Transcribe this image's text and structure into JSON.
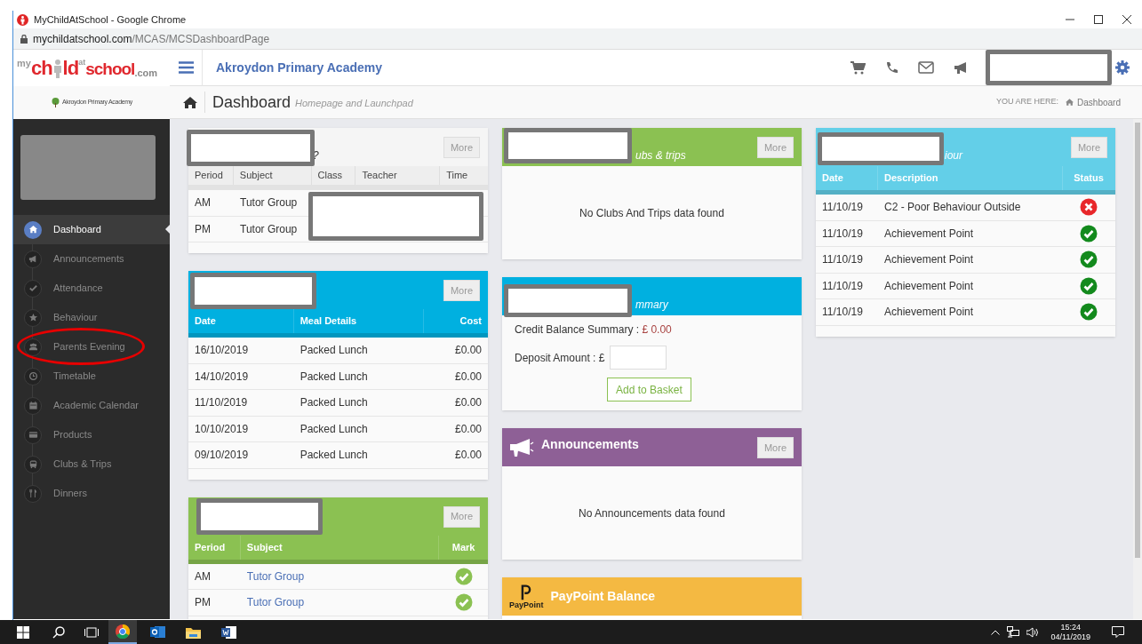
{
  "browser": {
    "title": "MyChildAtSchool - Google Chrome",
    "url_host": "mychildatschool.com",
    "url_path": "/MCAS/MCSDashboardPage"
  },
  "logo": {
    "parts": [
      "my",
      "ch",
      "ld",
      "at",
      "school",
      ".com"
    ]
  },
  "school_logo": {
    "name": "Akroydon Primary Academy"
  },
  "sidebar": {
    "items": [
      {
        "label": "Dashboard",
        "selected": true,
        "circled": false
      },
      {
        "label": "Announcements",
        "selected": false,
        "circled": false
      },
      {
        "label": "Attendance",
        "selected": false,
        "circled": false
      },
      {
        "label": "Behaviour",
        "selected": false,
        "circled": false
      },
      {
        "label": "Parents Evening",
        "selected": false,
        "circled": true
      },
      {
        "label": "Timetable",
        "selected": false,
        "circled": false
      },
      {
        "label": "Academic Calendar",
        "selected": false,
        "circled": false
      },
      {
        "label": "Products",
        "selected": false,
        "circled": false
      },
      {
        "label": "Clubs & Trips",
        "selected": false,
        "circled": false
      },
      {
        "label": "Dinners",
        "selected": false,
        "circled": false
      }
    ]
  },
  "topbar": {
    "title": "Akroydon Primary Academy"
  },
  "breadcrumb": {
    "title": "Dashboard",
    "subtitle": "Homepage and Launchpad",
    "label": "YOU ARE HERE:",
    "current": "Dashboard"
  },
  "columns": [
    {
      "cards": [
        {
          "kind": "table",
          "color": "#f5f5f5",
          "title_fragment": "?",
          "more": "More",
          "table": {
            "columns": [
              {
                "label": "Period",
                "kind": "text"
              },
              {
                "label": "Subject",
                "kind": "text"
              },
              {
                "label": "Class",
                "kind": "text"
              },
              {
                "label": "Teacher",
                "kind": "text"
              },
              {
                "label": "Time",
                "kind": "text"
              }
            ],
            "rows": [
              [
                "AM",
                "Tutor Group"
              ],
              [
                "PM",
                "Tutor Group"
              ]
            ]
          }
        },
        {
          "kind": "table",
          "color": "#00b0e0",
          "more": "More",
          "table": {
            "columns": [
              {
                "label": "Date",
                "kind": "text"
              },
              {
                "label": "Meal Details",
                "kind": "text"
              },
              {
                "label": "Cost",
                "kind": "amount"
              }
            ],
            "rows": [
              [
                "16/10/2019",
                "Packed Lunch",
                "£0.00"
              ],
              [
                "14/10/2019",
                "Packed Lunch",
                "£0.00"
              ],
              [
                "11/10/2019",
                "Packed Lunch",
                "£0.00"
              ],
              [
                "10/10/2019",
                "Packed Lunch",
                "£0.00"
              ],
              [
                "09/10/2019",
                "Packed Lunch",
                "£0.00"
              ]
            ]
          }
        },
        {
          "kind": "table",
          "color": "#8bc152",
          "more": "More",
          "table": {
            "columns": [
              {
                "label": "Period",
                "kind": "text"
              },
              {
                "label": "Subject",
                "kind": "link"
              },
              {
                "label": "Mark",
                "kind": "mark"
              }
            ],
            "rows": [
              [
                "AM",
                "Tutor Group",
                {
                  "passed": true
                }
              ],
              [
                "PM",
                "Tutor Group",
                {
                  "passed": true
                }
              ]
            ]
          }
        }
      ]
    },
    {
      "cards": [
        {
          "kind": "message",
          "color": "#8bc152",
          "title_fragment": "ubs & trips",
          "more": "More",
          "message": "No Clubs And Trips data found"
        },
        {
          "kind": "payment",
          "color": "#00b0e0",
          "title_fragment": "mmary",
          "credit_label": "Credit Balance Summary : ",
          "credit_value": "£ 0.00",
          "deposit_label": "Deposit Amount : £",
          "button": "Add to Basket"
        },
        {
          "kind": "announcements",
          "color": "#8e6096",
          "title": "Announcements",
          "more": "More",
          "message": "No Announcements data found"
        },
        {
          "kind": "paypoint",
          "color": "#f4b942",
          "title": "PayPoint Balance",
          "logo_text": "PayPoint"
        }
      ]
    },
    {
      "cards": [
        {
          "kind": "table",
          "color": "#63cfe8",
          "title_fragment": "iour",
          "more": "More",
          "table": {
            "columns": [
              {
                "label": "Date",
                "kind": "text"
              },
              {
                "label": "Description",
                "kind": "text"
              },
              {
                "label": "Status",
                "kind": "status"
              }
            ],
            "rows": [
              [
                "11/10/19",
                "C2 - Poor Behaviour Outside",
                {
                  "passed": false
                }
              ],
              [
                "11/10/19",
                "Achievement Point",
                {
                  "passed": true
                }
              ],
              [
                "11/10/19",
                "Achievement Point",
                {
                  "passed": true
                }
              ],
              [
                "11/10/19",
                "Achievement Point",
                {
                  "passed": true
                }
              ],
              [
                "11/10/19",
                "Achievement Point",
                {
                  "passed": true
                }
              ]
            ]
          }
        }
      ]
    }
  ],
  "taskbar": {
    "time": "15:24",
    "date": "04/11/2019"
  }
}
